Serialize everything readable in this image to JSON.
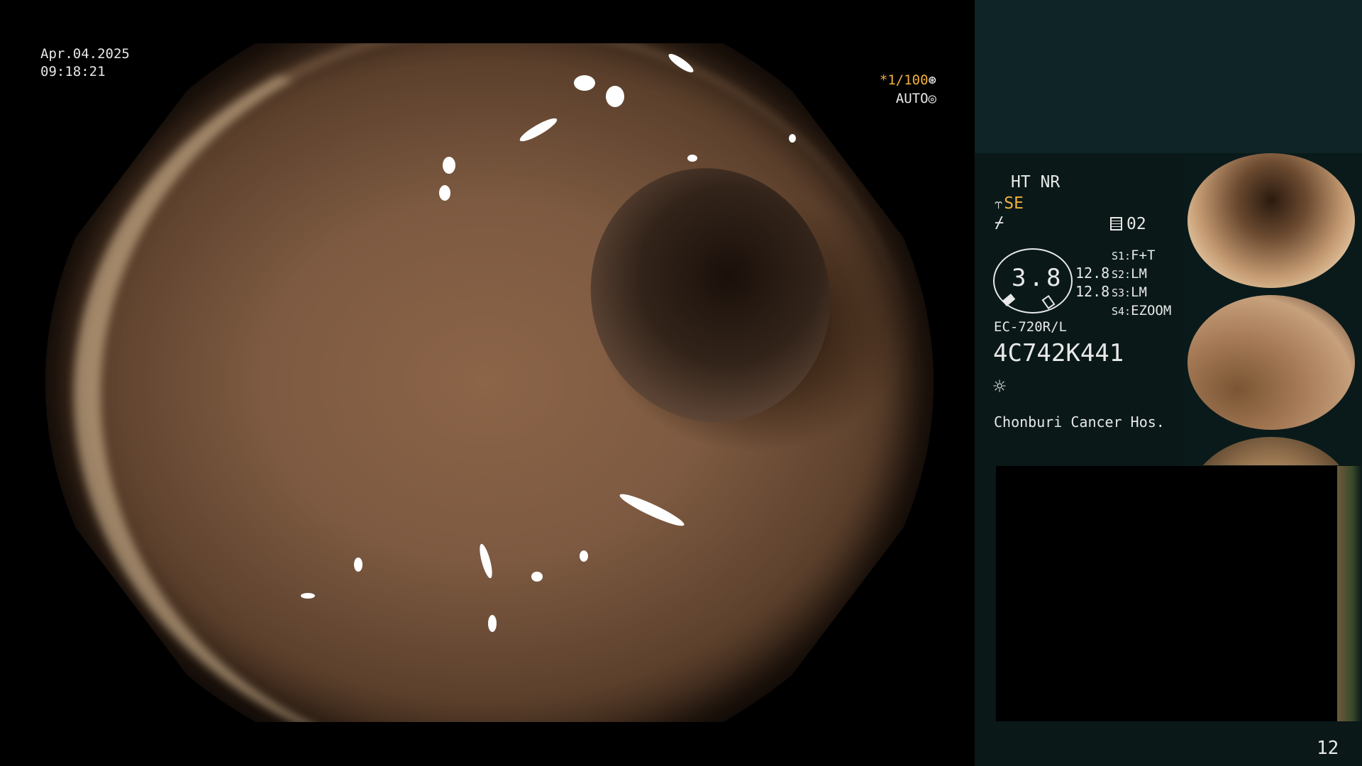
{
  "overlay": {
    "date": "Apr.04.2025",
    "time": "09:18:21",
    "shutter_speed": "*1/100",
    "shutter_mode": "AUTO"
  },
  "panel": {
    "ht_nr": "HT NR",
    "se": "SE",
    "memory_number": "02",
    "zoom_value": "3.8",
    "values": [
      "12.8",
      "12.8"
    ],
    "switch_modes": [
      {
        "key": "S1:",
        "value": "F+T"
      },
      {
        "key": "S2:",
        "value": "LM"
      },
      {
        "key": "S3:",
        "value": "LM"
      },
      {
        "key": "S4:",
        "value": "EZOOM"
      }
    ],
    "scope_model": "EC-720R/L",
    "scope_serial": "4C742K441",
    "hospital": "Chonburi Cancer Hos."
  },
  "page_number": "12",
  "icons": [
    "shutter-icon",
    "auto-iris-icon",
    "memory-icon",
    "lamp-icon",
    "function-icon"
  ],
  "colors": {
    "accent": "#f2b13a",
    "panel": "#0a1818",
    "panel_top": "#0e2426"
  }
}
